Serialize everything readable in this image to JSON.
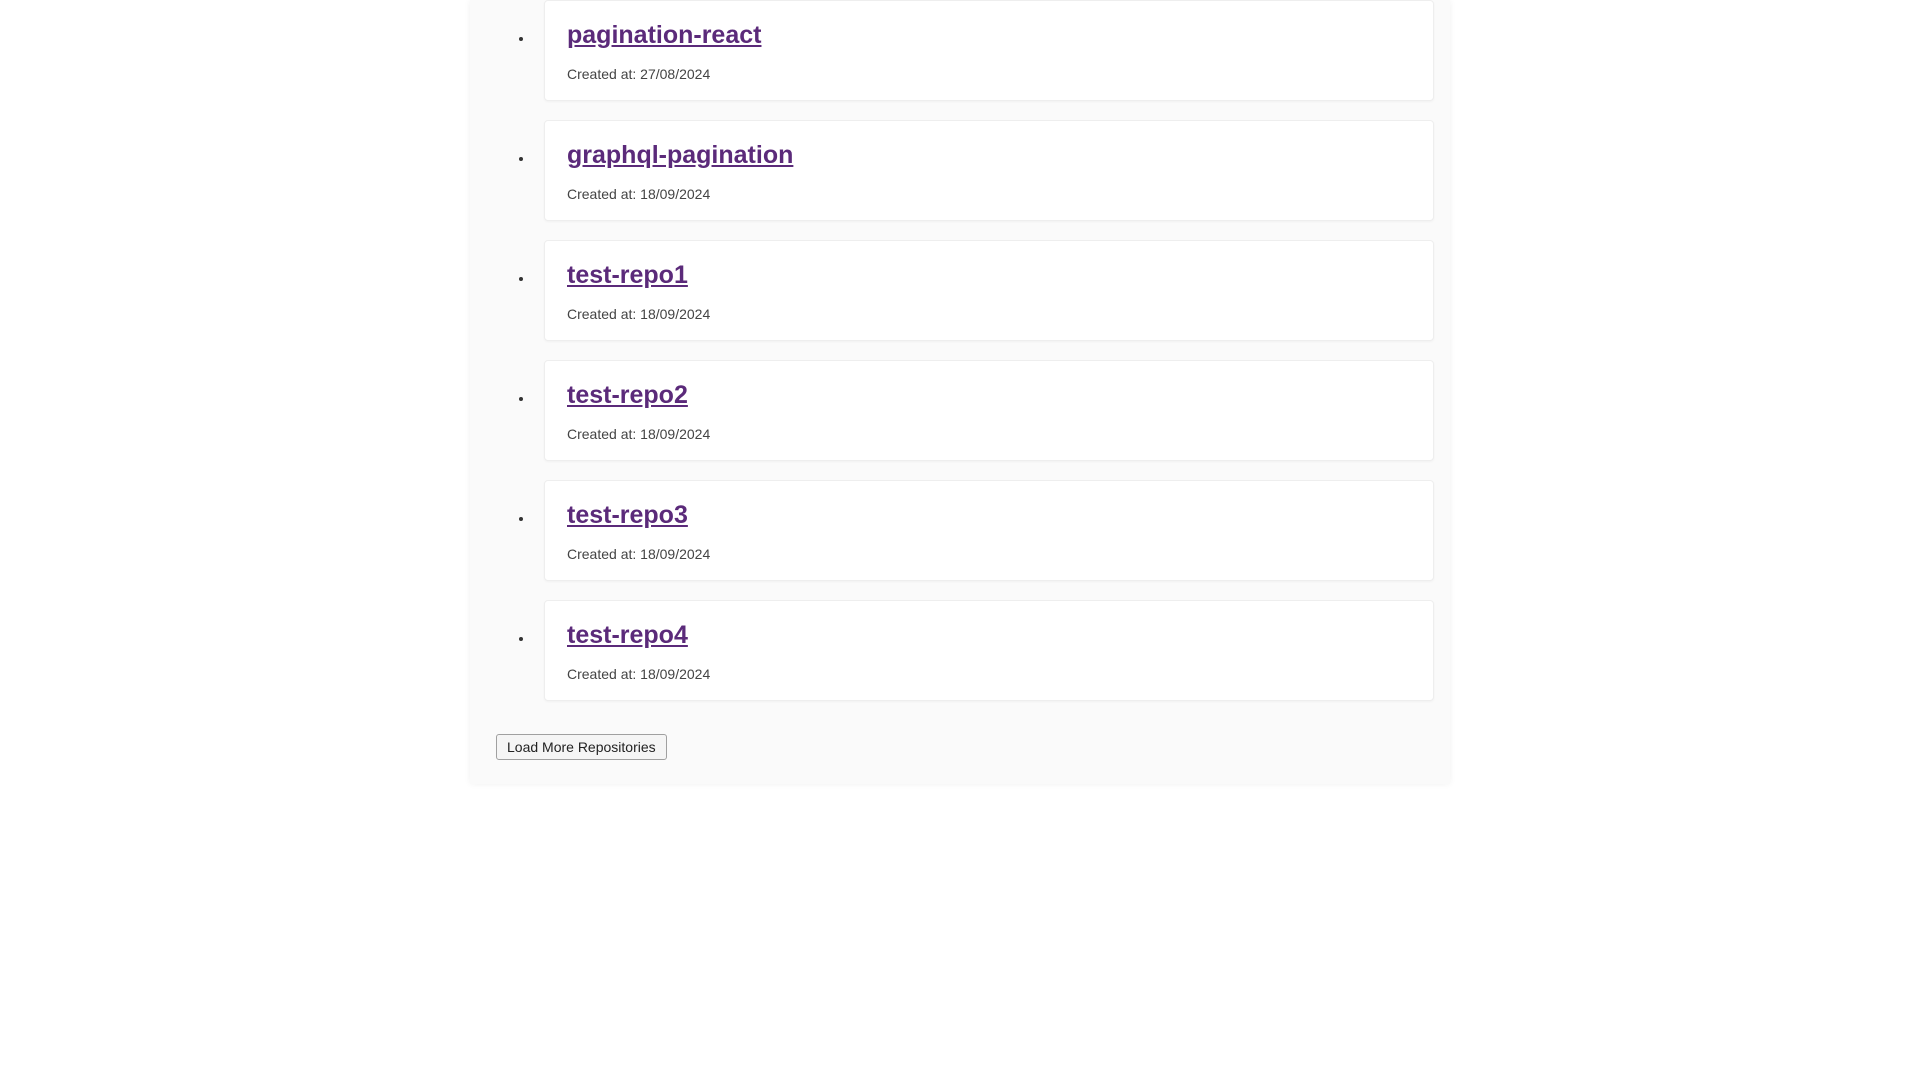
{
  "created_prefix": "Created at: ",
  "repositories": [
    {
      "name": "pagination-react",
      "created_at": "27/08/2024"
    },
    {
      "name": "graphql-pagination",
      "created_at": "18/09/2024"
    },
    {
      "name": "test-repo1",
      "created_at": "18/09/2024"
    },
    {
      "name": "test-repo2",
      "created_at": "18/09/2024"
    },
    {
      "name": "test-repo3",
      "created_at": "18/09/2024"
    },
    {
      "name": "test-repo4",
      "created_at": "18/09/2024"
    }
  ],
  "load_more_label": "Load More Repositories"
}
